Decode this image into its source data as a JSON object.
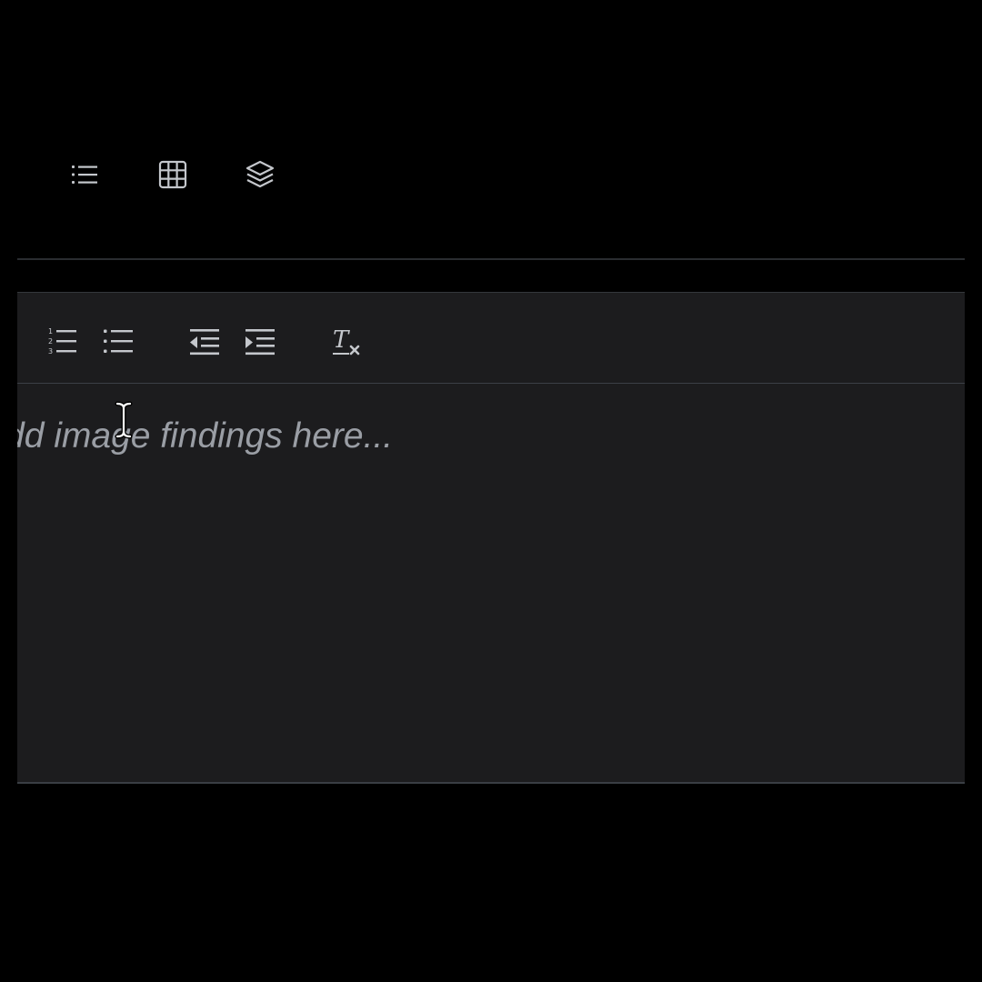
{
  "top_toolbar": {
    "icons": [
      "bulleted-list-icon",
      "table-grid-icon",
      "layers-icon"
    ]
  },
  "editor_toolbar": {
    "icons": [
      "numbered-list-icon",
      "bulleted-list-icon",
      "outdent-icon",
      "indent-icon",
      "clear-formatting-icon"
    ]
  },
  "editor": {
    "placeholder": "Add image findings here..."
  },
  "colors": {
    "background": "#000000",
    "editor_background": "#1c1c1e",
    "icon": "#c4c7cc",
    "placeholder_text": "#9a9ea5",
    "border": "#3a3e44"
  }
}
